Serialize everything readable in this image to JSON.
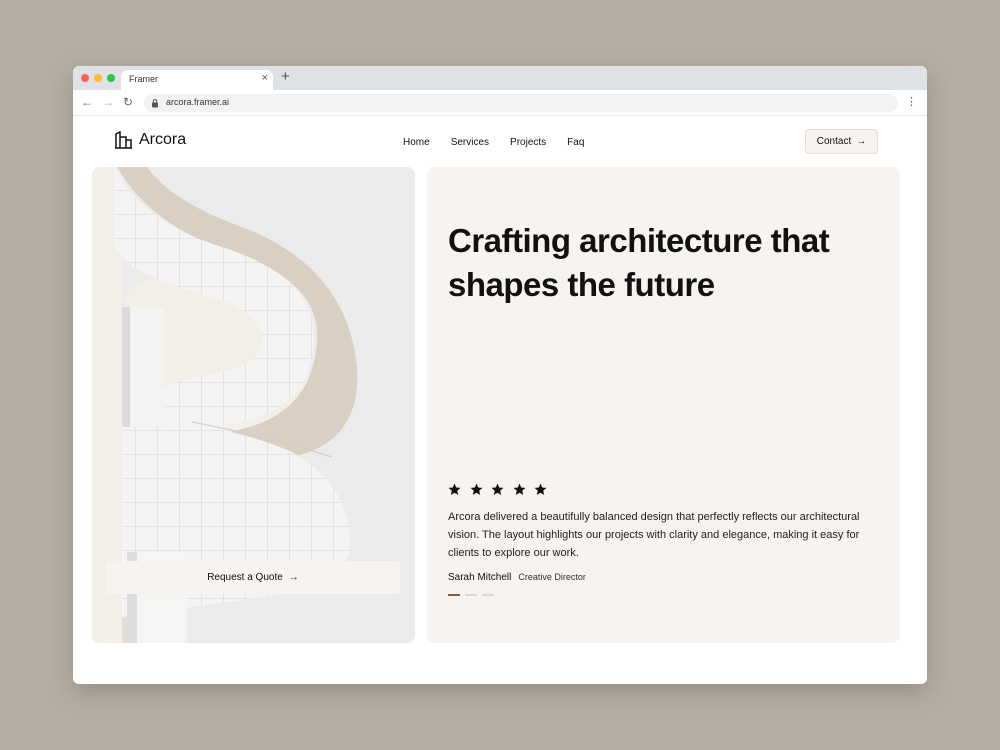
{
  "browser": {
    "tab_title": "Framer",
    "url": "arcora.framer.ai"
  },
  "site": {
    "brand": "Arcora",
    "nav": [
      "Home",
      "Services",
      "Projects",
      "Faq"
    ],
    "contact_label": "Contact"
  },
  "hero": {
    "headline_line1": "Crafting architecture that",
    "headline_line2": "shapes the future",
    "cta_label": "Request a Quote",
    "rating_stars": 5,
    "testimonial": "Arcora delivered a beautifully balanced design that perfectly reflects our architectural vision. The layout highlights our projects with clarity and elegance, making it easy for clients to explore our work.",
    "author_name": "Sarah Mitchell",
    "author_role": "Creative Director",
    "pager_count": 3,
    "pager_active": 1
  },
  "colors": {
    "background": "#b6aea3",
    "panel": "#f6f3f1",
    "button": "#f7f3f1",
    "pager_active": "#8b5a4a"
  },
  "icons": {
    "logo": "building-icon",
    "contact": "arrow-right-icon",
    "cta": "arrow-right-icon",
    "rating": "star-icon"
  }
}
